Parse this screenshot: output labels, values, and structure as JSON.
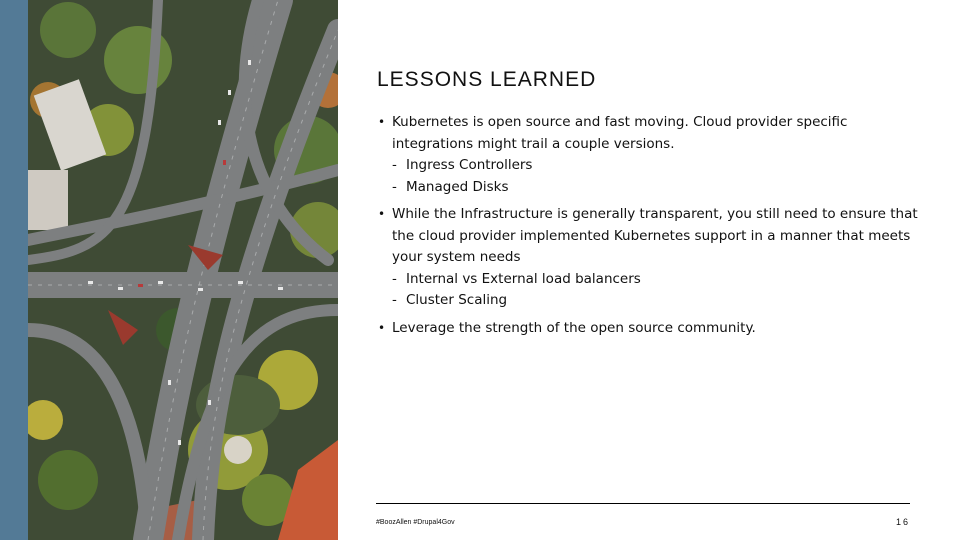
{
  "slide": {
    "title": "LESSONS LEARNED",
    "bullets": [
      {
        "text": "Kubernetes is open source and fast moving. Cloud provider specific integrations might trail a couple versions.",
        "subitems": [
          "Ingress Controllers",
          "Managed Disks"
        ]
      },
      {
        "text": "While the Infrastructure is generally transparent, you still need to ensure that the cloud provider implemented Kubernetes support in a manner that meets your system needs",
        "subitems": [
          "Internal vs External load balancers",
          "Cluster Scaling"
        ]
      },
      {
        "text": "Leverage the strength of the open source community.",
        "subitems": []
      }
    ],
    "bullet_glyph": "•",
    "sub_glyph": "-",
    "footer": {
      "hashtags": "#BoozAllen #Drupal4Gov",
      "page_number": "16"
    },
    "image": {
      "description": "aerial view of highway interchange with trees"
    },
    "colors": {
      "accent_bar": "#537a96"
    }
  }
}
